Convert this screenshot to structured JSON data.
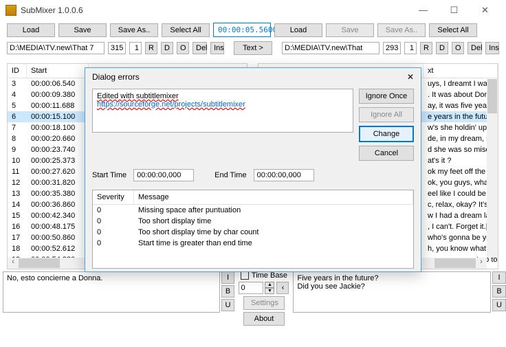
{
  "window": {
    "title": "SubMixer 1.0.0.6"
  },
  "toolbar": {
    "load": "Load",
    "save": "Save",
    "saveas": "Save As..",
    "selectall": "Select All",
    "timecode": "00:00:05.5600",
    "text": "Text >"
  },
  "left": {
    "path": "D:\\MEDIA\\TV.new\\That 7",
    "num1": "315",
    "num2": "1",
    "r": "R",
    "d": "D",
    "o": "O",
    "del": "Del",
    "ins": "Ins",
    "preview": "No, esto concierne a Donna."
  },
  "right": {
    "path": "D:\\MEDIA\\TV.new\\That",
    "num1": "293",
    "num2": "1",
    "r": "R",
    "d": "D",
    "o": "O",
    "del": "Del",
    "ins": "Ins",
    "preview": "Five years in the future?\nDid you see Jackie?"
  },
  "headers": {
    "id": "ID",
    "start": "Start",
    "text": "xt"
  },
  "leftRows": [
    {
      "id": "3",
      "start": "00:00:06.540",
      "text": ""
    },
    {
      "id": "4",
      "start": "00:00:09.380",
      "text": ""
    },
    {
      "id": "5",
      "start": "00:00:11.688",
      "text": ""
    },
    {
      "id": "6",
      "start": "00:00:15.100",
      "text": ""
    },
    {
      "id": "7",
      "start": "00:00:18.100",
      "text": ""
    },
    {
      "id": "8",
      "start": "00:00:20.660",
      "text": ""
    },
    {
      "id": "9",
      "start": "00:00:23.740",
      "text": ""
    },
    {
      "id": "10",
      "start": "00:00:25.373",
      "text": ""
    },
    {
      "id": "11",
      "start": "00:00:27.620",
      "text": ""
    },
    {
      "id": "12",
      "start": "00:00:31.820",
      "text": ""
    },
    {
      "id": "13",
      "start": "00:00:35.380",
      "text": ""
    },
    {
      "id": "14",
      "start": "00:00:36.860",
      "text": ""
    },
    {
      "id": "15",
      "start": "00:00:42.340",
      "text": ""
    },
    {
      "id": "16",
      "start": "00:00:48.175",
      "text": ""
    },
    {
      "id": "17",
      "start": "00:00:50.860",
      "text": ""
    },
    {
      "id": "18",
      "start": "00:00:52.612",
      "text": ""
    },
    {
      "id": "19",
      "start": "00:00:54.380",
      "text": ""
    }
  ],
  "rightRows": [
    {
      "text": "uys, I dreamt I was p"
    },
    {
      "text": ". It was about Donn"
    },
    {
      "text": "ay, it was five years"
    },
    {
      "text": "e years in the future"
    },
    {
      "text": "w's she holdin' up?|"
    },
    {
      "text": "de, in my dream, Do"
    },
    {
      "text": "d she was so misera"
    },
    {
      "text": "at's it ?"
    },
    {
      "text": "ok my feet off the ta"
    },
    {
      "text": "ok, you guys, what i"
    },
    {
      "text": "eel like I could be|rui"
    },
    {
      "text": "c, relax, okay? It's ju"
    },
    {
      "text": "w I had a dream las"
    },
    {
      "text": ", I can't. Forget it.|It'"
    },
    {
      "text": "who's gonna be you"
    },
    {
      "text": "h, you know what? W"
    },
    {
      "text": "ause, you want up to"
    }
  ],
  "mid": {
    "timebase": "Time Base",
    "spinner": "0",
    "settings": "Settings",
    "about": "About",
    "i": "I",
    "b": "B",
    "u": "U"
  },
  "dialog": {
    "title": "Dialog errors",
    "line1": "Edited with subtitlemixer",
    "line2": "https://sourceforge.net/projects/subtitlemixer",
    "ignoreOnce": "Ignore Once",
    "ignoreAll": "Ignore All",
    "change": "Change",
    "cancel": "Cancel",
    "starttime": "Start Time",
    "starttimeval": "00:00:00,000",
    "endtime": "End Time",
    "endtimeval": "00:00:00,000",
    "sevhead": "Severity",
    "msghead": "Message",
    "errors": [
      {
        "sev": "0",
        "msg": "Missing space after puntuation"
      },
      {
        "sev": "0",
        "msg": "Too short display time"
      },
      {
        "sev": "0",
        "msg": "Too short display time by char count"
      },
      {
        "sev": "0",
        "msg": "Start time is greater than end time"
      }
    ]
  }
}
